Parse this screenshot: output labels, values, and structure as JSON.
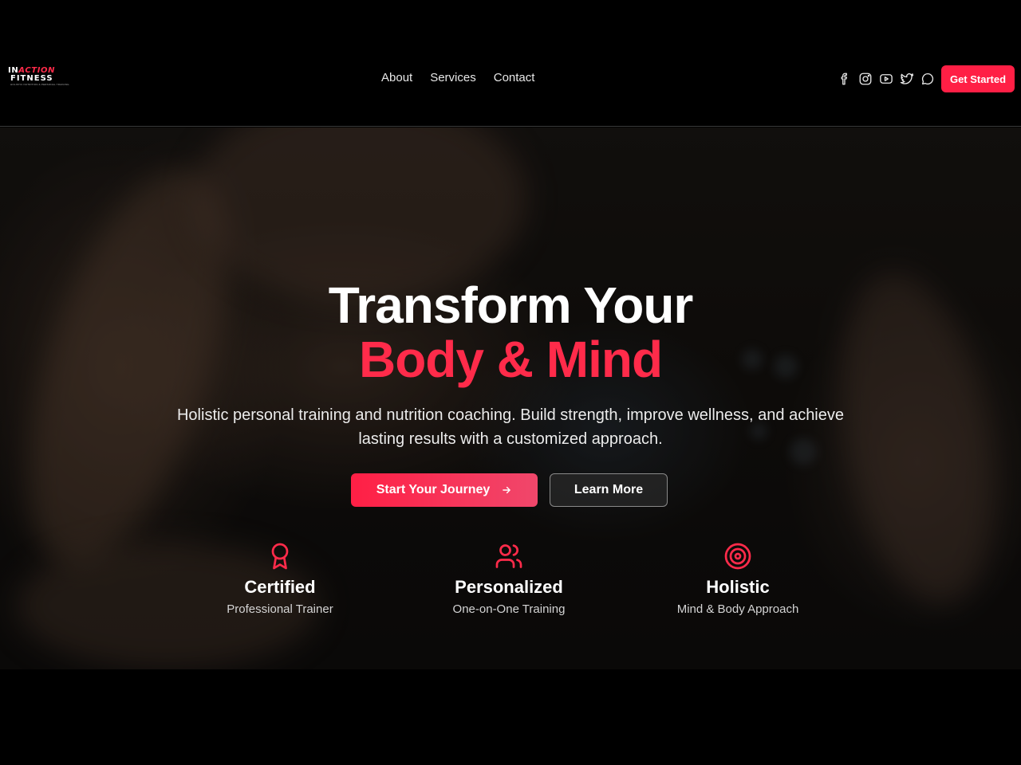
{
  "brand": {
    "logo_line1_a": "IN",
    "logo_line1_b": "ACTION",
    "logo_line2": "FITNESS",
    "logo_line3": "HOLISTIC NUTRITION & PERSONAL TRAINING",
    "accent_color": "#ff2b4a"
  },
  "nav": {
    "links": [
      "About",
      "Services",
      "Contact"
    ],
    "social_icons": [
      "facebook-icon",
      "instagram-icon",
      "youtube-icon",
      "twitter-icon",
      "chat-icon"
    ],
    "cta_label": "Get Started"
  },
  "hero": {
    "headline_line1": "Transform Your",
    "headline_line2": "Body & Mind",
    "subtitle": "Holistic personal training and nutrition coaching. Build strength, improve wellness, and achieve lasting results with a customized approach.",
    "primary_button": "Start Your Journey",
    "primary_button_icon": "arrow-right-icon",
    "secondary_button": "Learn More"
  },
  "features": [
    {
      "icon": "award-icon",
      "title": "Certified",
      "subtitle": "Professional Trainer"
    },
    {
      "icon": "users-icon",
      "title": "Personalized",
      "subtitle": "One-on-One Training"
    },
    {
      "icon": "target-icon",
      "title": "Holistic",
      "subtitle": "Mind & Body Approach"
    }
  ]
}
